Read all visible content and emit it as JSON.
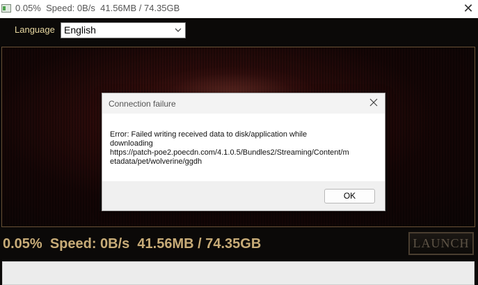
{
  "window": {
    "title": "0.05%  Speed: 0B/s  41.56MB / 74.35GB",
    "close_symbol": "✕"
  },
  "language": {
    "label": "Language",
    "selected": "English"
  },
  "progress": {
    "text": "0.05%  Speed: 0B/s  41.56MB / 74.35GB",
    "percent": 0.05
  },
  "launch": {
    "label": "LAUNCH"
  },
  "dialog": {
    "title": "Connection failure",
    "message_lines": [
      "Error: Failed writing received data to disk/application while",
      "downloading",
      "https://patch-poe2.poecdn.com/4.1.0.5/Bundles2/Streaming/Content/m",
      "etadata/pet/wolverine/ggdh"
    ],
    "ok_label": "OK"
  },
  "icons": {
    "app": "app-icon",
    "window_close": "close-icon",
    "dialog_close": "close-icon",
    "dropdown": "chevron-down-icon"
  },
  "colors": {
    "gold_text": "#c8ac78",
    "banner_border": "#6a5236",
    "launch_text": "#5e5446"
  }
}
